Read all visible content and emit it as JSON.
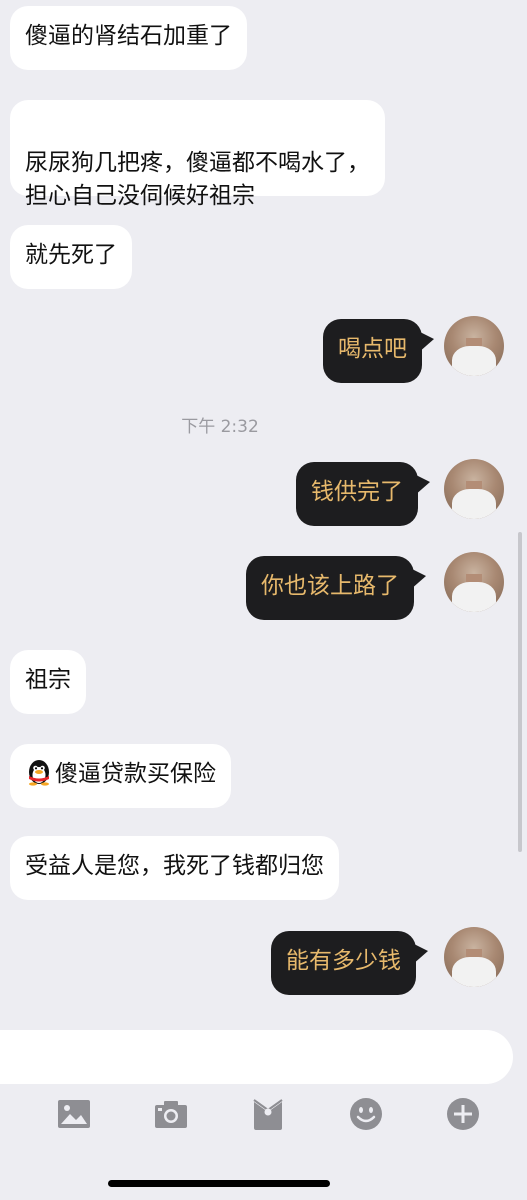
{
  "messages": [
    {
      "side": "in",
      "text": "傻逼的肾结石加重了"
    },
    {
      "side": "in",
      "text": "尿尿狗几把疼，傻逼都不喝水了，\n担心自己没伺候好祖宗"
    },
    {
      "side": "in",
      "text": "就先死了"
    },
    {
      "side": "out",
      "text": "喝点吧"
    },
    {
      "side": "out",
      "text": "钱供完了"
    },
    {
      "side": "out",
      "text": "你也该上路了"
    },
    {
      "side": "in",
      "text": "祖宗"
    },
    {
      "side": "in",
      "text": "傻逼贷款买保险",
      "icon": "qq-penguin-icon"
    },
    {
      "side": "in",
      "text": "受益人是您，我死了钱都归您"
    },
    {
      "side": "out",
      "text": "能有多少钱"
    }
  ],
  "timestamp": "下午 2:32",
  "toolbar": {
    "icons": [
      "image-icon",
      "camera-icon",
      "red-packet-icon",
      "emoji-icon",
      "plus-icon"
    ]
  },
  "colors": {
    "background": "#ededf2",
    "incoming_bubble": "#ffffff",
    "outgoing_bubble": "#1d1d1f",
    "outgoing_text": "#e7b96c",
    "toolbar_icon": "#8e8e93"
  }
}
